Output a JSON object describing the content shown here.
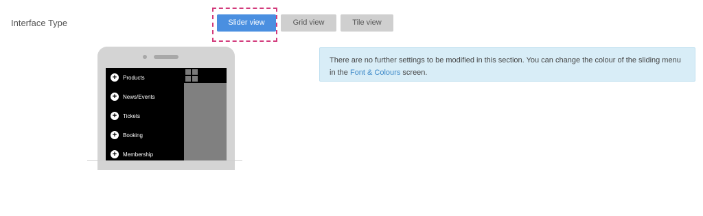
{
  "interface": {
    "label": "Interface Type"
  },
  "view_buttons": {
    "slider": "Slider view",
    "grid": "Grid view",
    "tile": "Tile view",
    "active": "slider"
  },
  "phone_menu": {
    "items": [
      "Products",
      "News/Events",
      "Tickets",
      "Booking",
      "Membership"
    ]
  },
  "info": {
    "text_before": "There are no further settings to be modified in this section. You can change the colour of the sliding menu in the ",
    "link": "Font & Colours",
    "text_after": " screen."
  },
  "colors": {
    "accent": "#4a8fe0",
    "highlight": "#d23a7b",
    "info_bg": "#d8edf7",
    "link": "#3a87c7"
  }
}
